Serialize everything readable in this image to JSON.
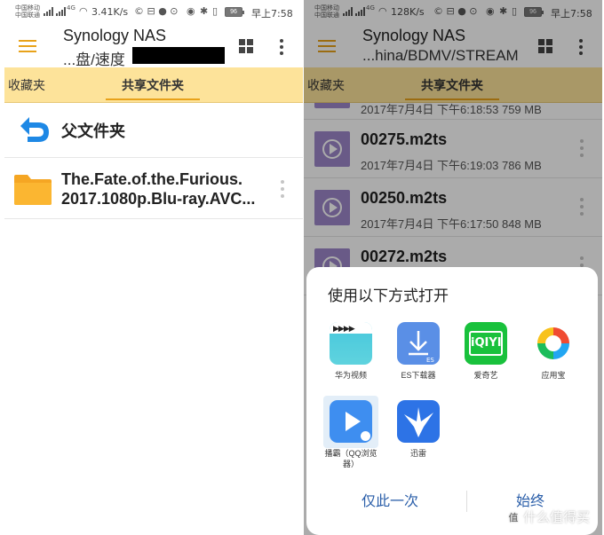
{
  "status_bar": {
    "carrier_1": "中国移动",
    "carrier_2": "中国联通",
    "net_type": "4G",
    "battery": "96",
    "time": "早上7:58",
    "left_speed": "3.41K/s",
    "right_speed": "128K/s"
  },
  "left": {
    "app_title": "Synology NAS",
    "path": "...盘/速度",
    "tabs": {
      "favorites": "收藏夹",
      "shared": "共享文件夹"
    },
    "parent_folder_label": "父文件夹",
    "folder": {
      "name_line1": "The.Fate.of.the.Furious.",
      "name_line2": "2017.1080p.Blu-ray.AVC..."
    }
  },
  "right": {
    "app_title": "Synology NAS",
    "path": "...hina/BDMV/STREAM",
    "tabs": {
      "favorites": "收藏夹",
      "shared": "共享文件夹"
    },
    "files": [
      {
        "name": "",
        "meta": "2017年7月4日 下午6:18:53 759 MB"
      },
      {
        "name": "00275.m2ts",
        "meta": "2017年7月4日 下午6:19:03 786 MB"
      },
      {
        "name": "00250.m2ts",
        "meta": "2017年7月4日 下午6:17:50 848 MB"
      },
      {
        "name": "00272.m2ts",
        "meta": ""
      }
    ],
    "sheet": {
      "title": "使用以下方式打开",
      "apps": [
        {
          "label": "华为视频",
          "icon": "huawei-video-icon"
        },
        {
          "label": "ES下载器",
          "icon": "es-downloader-icon"
        },
        {
          "label": "爱奇艺",
          "icon": "iqiyi-icon"
        },
        {
          "label": "应用宝",
          "icon": "yingyongbao-icon"
        },
        {
          "label": "播霸（QQ浏览器）",
          "icon": "qq-player-icon"
        },
        {
          "label": "迅雷",
          "icon": "xunlei-icon"
        }
      ],
      "once_button": "仅此一次",
      "always_button": "始终"
    }
  },
  "colors": {
    "accent": "#e8a21a",
    "tab_bg": "#fde39a",
    "link": "#2a5ea9",
    "file_icon": "#9d86c9",
    "folder": "#f5a623",
    "back_arrow": "#1e88e5"
  },
  "watermark": "什么值得买"
}
